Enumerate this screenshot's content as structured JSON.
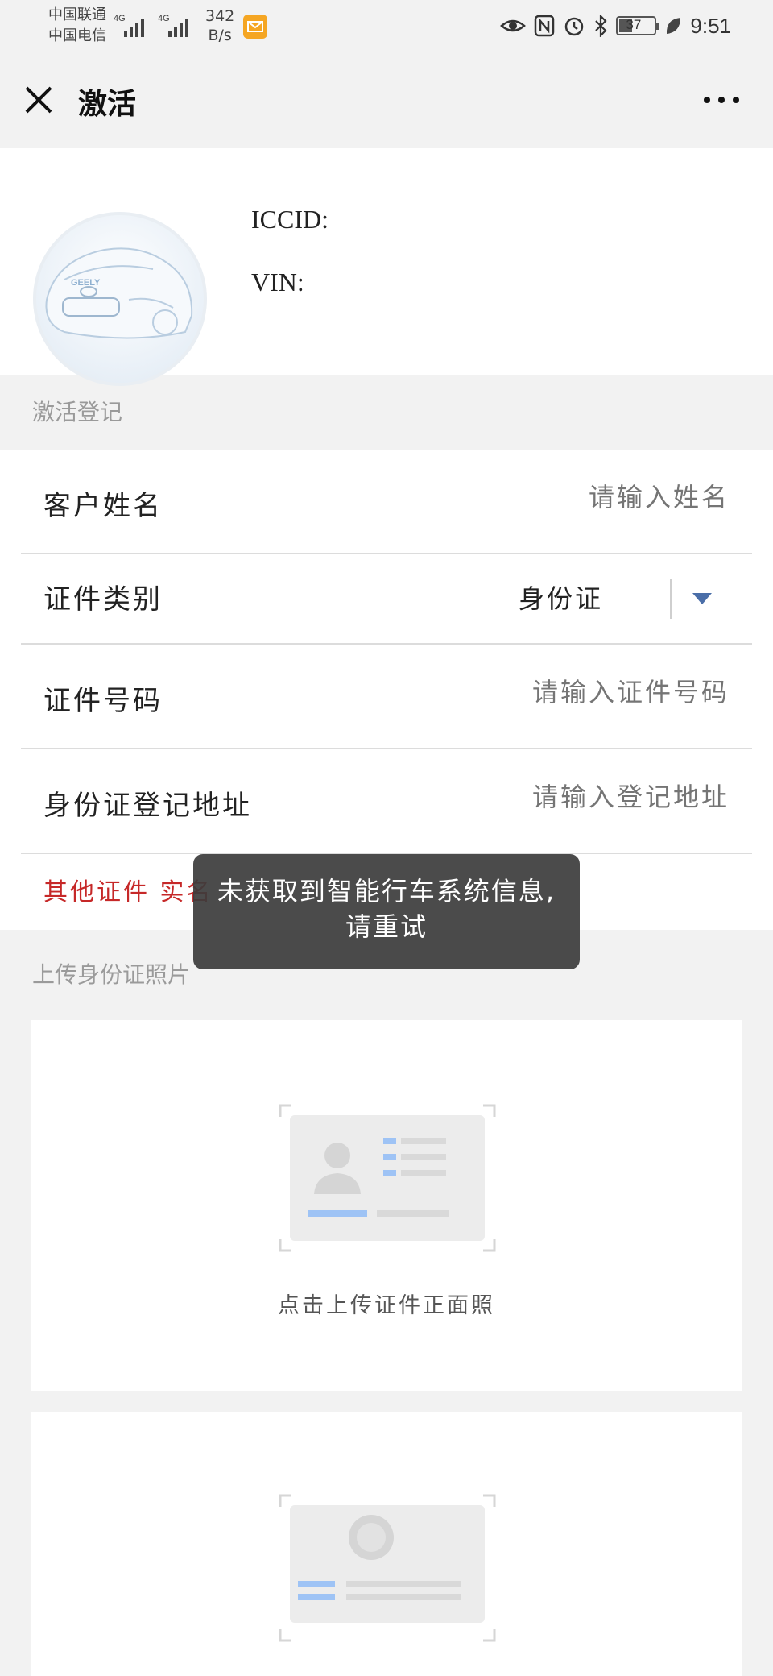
{
  "status_bar": {
    "carrier_1": "中国联通",
    "carrier_2": "中国电信",
    "network_1": "4G",
    "network_2": "4G",
    "speed_value": "342",
    "speed_unit": "B/s",
    "battery": "37",
    "time": "9:51"
  },
  "nav": {
    "title": "激活"
  },
  "car_info": {
    "iccid_label": "ICCID:",
    "vin_label": "VIN:",
    "brand": "GEELY"
  },
  "sections": {
    "activation_title": "激活登记",
    "upload_title": "上传身份证照片"
  },
  "form": {
    "name_label": "客户姓名",
    "name_placeholder": "请输入姓名",
    "id_type_label": "证件类别",
    "id_type_value": "身份证",
    "id_number_label": "证件号码",
    "id_number_placeholder": "请输入证件号码",
    "address_label": "身份证登记地址",
    "address_placeholder": "请输入登记地址",
    "other_id_note": "其他证件 实名"
  },
  "upload": {
    "front_label": "点击上传证件正面照"
  },
  "toast": {
    "message": "未获取到智能行车系统信息,请重试"
  },
  "colors": {
    "background": "#f2f2f2",
    "note_red": "#c62828",
    "caret_blue": "#4a6ea8",
    "upload_blue": "#9ec3f5"
  },
  "icons": [
    "close-icon",
    "more-icon",
    "dropdown-caret-icon",
    "id-card-front-icon",
    "id-card-back-icon",
    "eye-icon",
    "nfc-icon",
    "alarm-icon",
    "bluetooth-icon",
    "battery-icon",
    "leaf-icon",
    "message-icon"
  ]
}
